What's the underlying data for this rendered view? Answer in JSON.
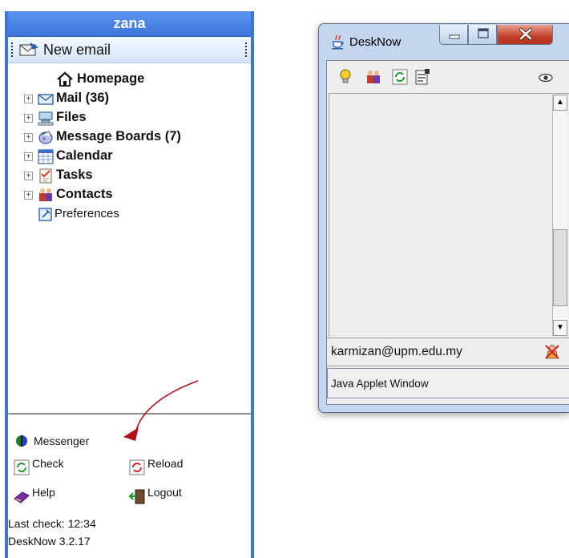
{
  "sidebar": {
    "user_name": "zana",
    "new_email_label": "New email",
    "tree": [
      {
        "label": "Homepage",
        "icon": "home-icon",
        "expandable": false
      },
      {
        "label": "Mail (36)",
        "icon": "mail-icon",
        "expandable": true
      },
      {
        "label": "Files",
        "icon": "files-icon",
        "expandable": true
      },
      {
        "label": "Message Boards (7)",
        "icon": "message-boards-icon",
        "expandable": true
      },
      {
        "label": "Calendar",
        "icon": "calendar-icon",
        "expandable": true
      },
      {
        "label": "Tasks",
        "icon": "tasks-icon",
        "expandable": true
      },
      {
        "label": "Contacts",
        "icon": "contacts-icon",
        "expandable": true
      },
      {
        "label": "Preferences",
        "icon": "preferences-icon",
        "expandable": false
      }
    ],
    "messenger_label": "Messenger",
    "check_label": "Check",
    "reload_label": "Reload",
    "help_label": "Help",
    "logout_label": "Logout",
    "last_check": "Last check: 12:34",
    "version": "DeskNow 3.2.17"
  },
  "applet": {
    "title": "DeskNow",
    "account_email": "karmizan@upm.edu.my",
    "warning": "Java Applet Window",
    "toolbar_icons": [
      "lightbulb-icon",
      "contacts-icon",
      "refresh-icon",
      "properties-icon",
      "eye-icon"
    ]
  },
  "colors": {
    "header_blue": "#3d75da",
    "annotation_arrow": "#b0111a"
  }
}
